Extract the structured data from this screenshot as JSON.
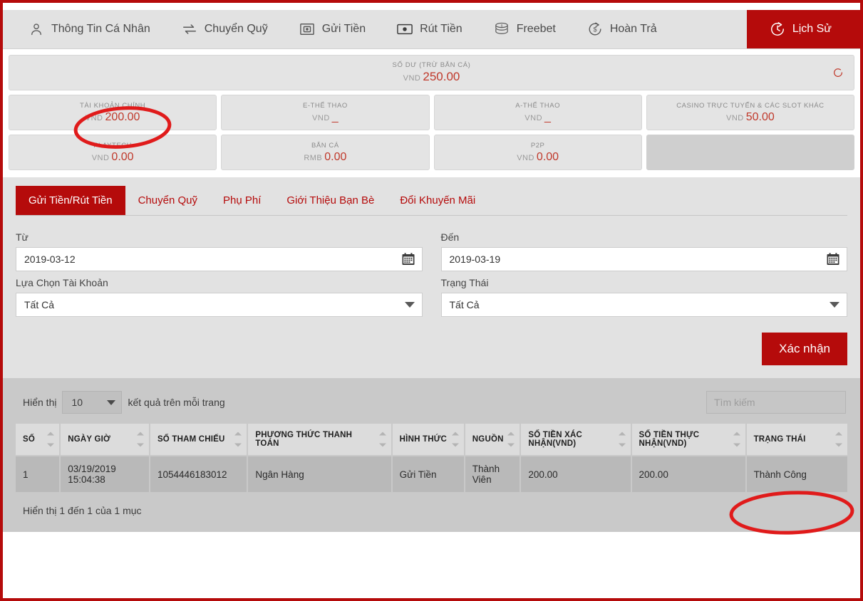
{
  "nav": {
    "items": [
      {
        "label": "Thông Tin Cá Nhân",
        "icon": "user-icon",
        "active": false
      },
      {
        "label": "Chuyển Quỹ",
        "icon": "transfer-icon",
        "active": false
      },
      {
        "label": "Gửi Tiền",
        "icon": "deposit-icon",
        "active": false
      },
      {
        "label": "Rút Tiền",
        "icon": "withdraw-icon",
        "active": false
      },
      {
        "label": "Freebet",
        "icon": "coins-icon",
        "active": false
      },
      {
        "label": "Hoàn Trả",
        "icon": "rebate-icon",
        "active": false
      },
      {
        "label": "Lịch Sử",
        "icon": "history-clock-icon",
        "active": true
      }
    ]
  },
  "balance": {
    "total": {
      "label": "SỐ DƯ (TRỪ BẮN CÁ)",
      "currency": "VND",
      "amount": "250.00"
    },
    "refresh_icon": "refresh-icon",
    "accounts": [
      {
        "label": "TÀI KHOẢN CHÍNH",
        "currency": "VND",
        "amount": "200.00",
        "empty": false
      },
      {
        "label": "E-THỂ THAO",
        "currency": "VND",
        "amount": "_",
        "empty": false
      },
      {
        "label": "A-THỂ THAO",
        "currency": "VND",
        "amount": "_",
        "empty": false
      },
      {
        "label": "CASINO TRỰC TUYẾN & CÁC SLOT KHÁC",
        "currency": "VND",
        "amount": "50.00",
        "empty": false
      },
      {
        "label": "PLAYTECH",
        "currency": "VND",
        "amount": "0.00",
        "empty": false
      },
      {
        "label": "BẮN CÁ",
        "currency": "RMB",
        "amount": "0.00",
        "empty": false
      },
      {
        "label": "P2P",
        "currency": "VND",
        "amount": "0.00",
        "empty": false
      },
      {
        "label": "",
        "currency": "",
        "amount": "",
        "empty": true
      }
    ]
  },
  "tabs": [
    {
      "label": "Gửi Tiền/Rút Tiền",
      "active": true
    },
    {
      "label": "Chuyển Quỹ",
      "active": false
    },
    {
      "label": "Phụ Phí",
      "active": false
    },
    {
      "label": "Giới Thiệu Bạn Bè",
      "active": false
    },
    {
      "label": "Đổi Khuyến Mãi",
      "active": false
    }
  ],
  "filters": {
    "from": {
      "label": "Từ",
      "value": "2019-03-12",
      "icon": "calendar-icon"
    },
    "to": {
      "label": "Đến",
      "value": "2019-03-19",
      "icon": "calendar-icon"
    },
    "account": {
      "label": "Lựa Chọn Tài Khoản",
      "value": "Tất Cả",
      "icon": "chevron-down-icon"
    },
    "status": {
      "label": "Trạng Thái",
      "value": "Tất Cả",
      "icon": "chevron-down-icon"
    },
    "confirm_label": "Xác nhận"
  },
  "table": {
    "length_prefix": "Hiển thị",
    "length_value": "10",
    "length_suffix": "kết quả trên mỗi trang",
    "search_placeholder": "Tìm kiếm",
    "search_value": "",
    "columns": [
      "SỐ",
      "NGÀY GIỜ",
      "SỐ THAM CHIẾU",
      "PHƯƠNG THỨC THANH TOÁN",
      "HÌNH THỨC",
      "NGUỒN",
      "SỐ TIỀN XÁC NHẬN(VND)",
      "SỐ TIỀN THỰC NHẬN(VND)",
      "TRẠNG THÁI"
    ],
    "rows": [
      {
        "no": "1",
        "datetime": "03/19/2019 15:04:38",
        "reference": "1054446183012",
        "payment_method": "Ngân Hàng",
        "type": "Gửi Tiền",
        "source": "Thành Viên",
        "amount_confirmed": "200.00",
        "amount_received": "200.00",
        "status": "Thành Công"
      }
    ],
    "info": "Hiển thị 1 đến 1 của 1 mục"
  },
  "colors": {
    "brand_red": "#b50b0b",
    "amount_red": "#c0392b",
    "annotation_red": "#e01b1b",
    "panel_gray": "#e2e2e2",
    "table_gray": "#c9c9c9"
  },
  "annotations": [
    {
      "name": "highlight-main-account",
      "shape": "ellipse"
    },
    {
      "name": "highlight-status-success",
      "shape": "ellipse"
    }
  ]
}
